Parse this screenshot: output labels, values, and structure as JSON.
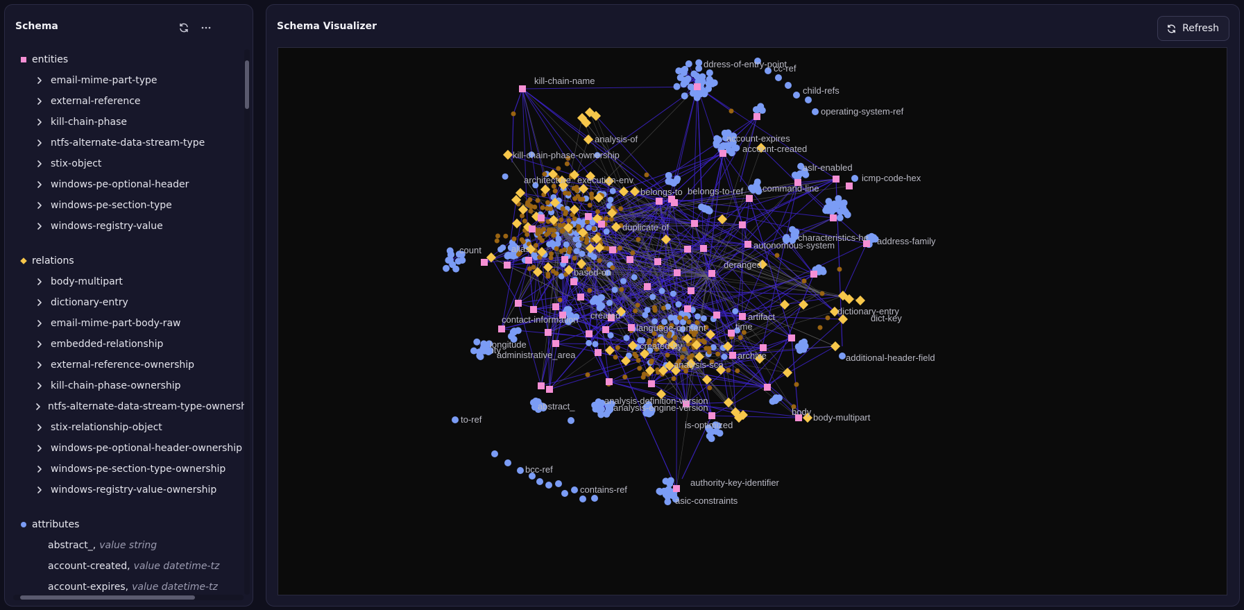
{
  "schema": {
    "title": "Schema",
    "sections": {
      "entities": {
        "label": "entities",
        "color": "#f58fd4",
        "items": [
          "email-mime-part-type",
          "external-reference",
          "kill-chain-phase",
          "ntfs-alternate-data-stream-type",
          "stix-object",
          "windows-pe-optional-header",
          "windows-pe-section-type",
          "windows-registry-value"
        ]
      },
      "relations": {
        "label": "relations",
        "color": "#f7c74b",
        "items": [
          "body-multipart",
          "dictionary-entry",
          "email-mime-part-body-raw",
          "embedded-relationship",
          "external-reference-ownership",
          "kill-chain-phase-ownership",
          "ntfs-alternate-data-stream-type-ownership",
          "stix-relationship-object",
          "windows-pe-optional-header-ownership",
          "windows-pe-section-type-ownership",
          "windows-registry-value-ownership"
        ]
      },
      "attributes": {
        "label": "attributes",
        "color": "#7b9cf5",
        "items": [
          {
            "name": "abstract_",
            "type": "value string"
          },
          {
            "name": "account-created",
            "type": "value datetime-tz"
          },
          {
            "name": "account-expires",
            "type": "value datetime-tz"
          }
        ]
      }
    }
  },
  "visualizer": {
    "title": "Schema Visualizer",
    "refresh_label": "Refresh",
    "colors": {
      "entity": "#f58fd4",
      "relation": "#f7c74b",
      "attribute": "#7b9cf5",
      "role": "#9a6412",
      "edge": "#3b22c4",
      "edge_gray": "#6b6b6b",
      "background": "#0b0b0b"
    },
    "labels": [
      "kill-chain-name",
      "ddress-of-entry-point",
      "cc-ref",
      "child-refs",
      "operating-system-ref",
      "analysis-of",
      "account-expires",
      "account-created",
      "kill-chain-phase-ownership",
      "architecture",
      "execution-env",
      "belongs-to",
      "belongs-to-ref",
      "aslr-enabled",
      "icmp-code-hex",
      "command-line",
      "characteristics-he",
      "address-family",
      "duplicate-of",
      "autonomous-system",
      "count",
      "alias",
      "deranged",
      "based-on",
      "contact-information",
      "created",
      "language-content",
      "time",
      "artifact",
      "dictionary-entry",
      "dict-key",
      "longitude",
      "ity",
      "administrative_area",
      "created-by",
      "archive",
      "analysis-sco",
      "additional-header-field",
      "analysis-definition-version",
      "analysis-engine-version",
      "abstract_",
      "body",
      "body-multipart",
      "to-ref",
      "is-optimized",
      "bcc-ref",
      "authority-key-identifier",
      "contains-ref",
      "asic-constraints"
    ]
  }
}
